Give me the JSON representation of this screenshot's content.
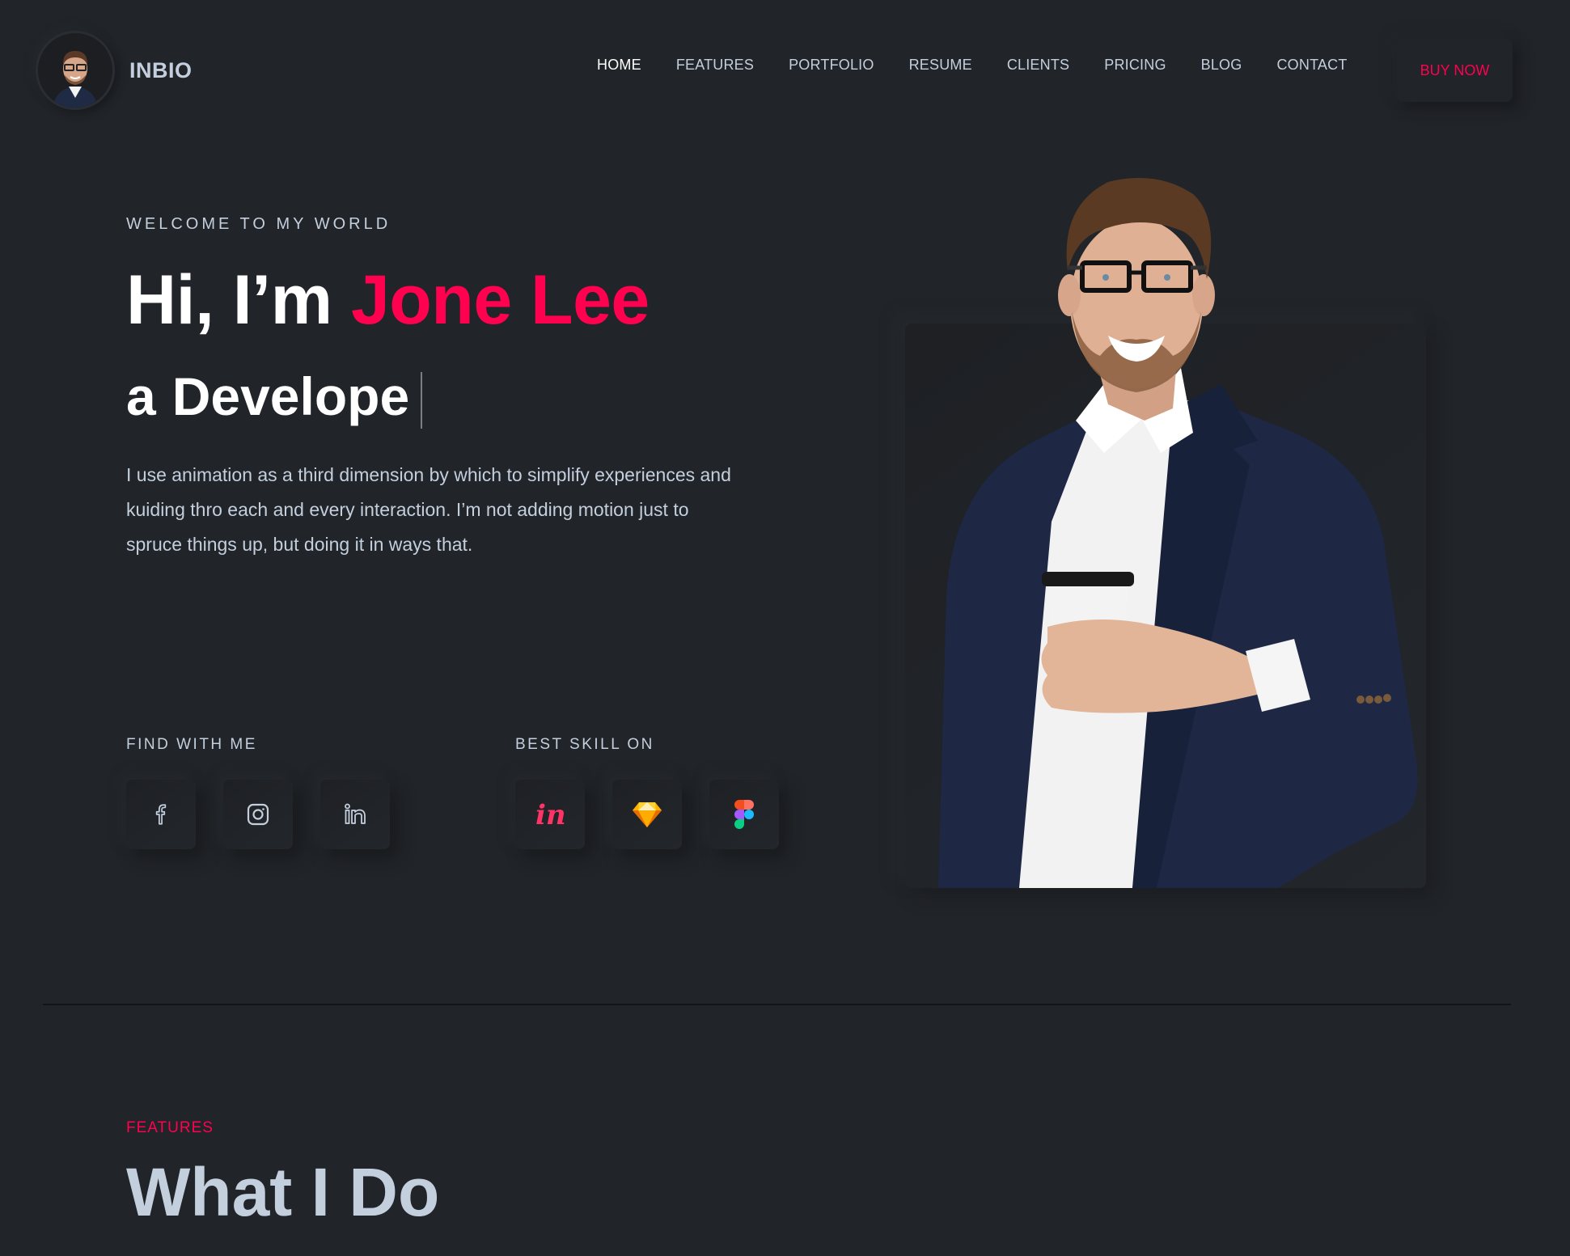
{
  "header": {
    "logo_text": "INBIO",
    "nav": [
      {
        "label": "HOME",
        "active": true
      },
      {
        "label": "FEATURES"
      },
      {
        "label": "PORTFOLIO"
      },
      {
        "label": "RESUME"
      },
      {
        "label": "CLIENTS"
      },
      {
        "label": "PRICING"
      },
      {
        "label": "BLOG"
      },
      {
        "label": "CONTACT"
      }
    ],
    "buy_label": "BUY NOW"
  },
  "hero": {
    "welcome": "WELCOME TO MY WORLD",
    "greeting": "Hi, I’m ",
    "name": "Jone Lee",
    "sub_prefix": "a",
    "sub_typed": "Develope",
    "description": "I use animation as a third dimension by which to simplify experiences and kuiding thro each and every interaction. I’m not adding motion just to spruce things up, but doing it in ways that.",
    "find_label": "FIND WITH ME",
    "skill_label": "BEST SKILL ON",
    "socials": [
      "facebook-icon",
      "instagram-icon",
      "linkedin-icon"
    ],
    "skills": [
      "invision-icon",
      "sketch-icon",
      "figma-icon"
    ]
  },
  "colors": {
    "accent": "#ff014f",
    "background": "#212428",
    "text": "#c4cfde"
  },
  "features": {
    "tag": "FEATURES",
    "title": "What I Do"
  }
}
